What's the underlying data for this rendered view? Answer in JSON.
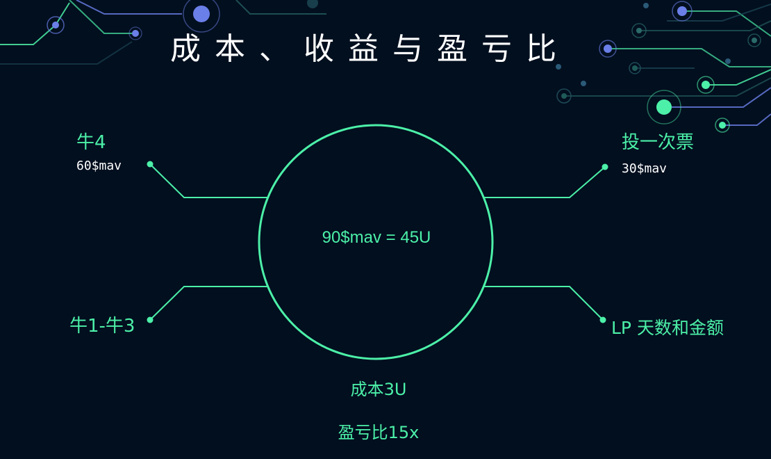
{
  "title": "成本、收益与盈亏比",
  "center": {
    "label": "90$mav = 45U"
  },
  "nodes": {
    "top_left": {
      "label": "牛4",
      "sub": "60$mav"
    },
    "top_right": {
      "label": "投一次票",
      "sub": "30$mav"
    },
    "bottom_left": {
      "label": "牛1-牛3"
    },
    "bottom_right": {
      "label": "LP 天数和金额"
    }
  },
  "footer": {
    "cost": "成本3U",
    "ratio": "盈亏比15x"
  },
  "colors": {
    "background": "#020f1f",
    "accent_green": "#4cf0a8",
    "accent_blue": "#6b7fe8",
    "title": "#ffffff"
  }
}
